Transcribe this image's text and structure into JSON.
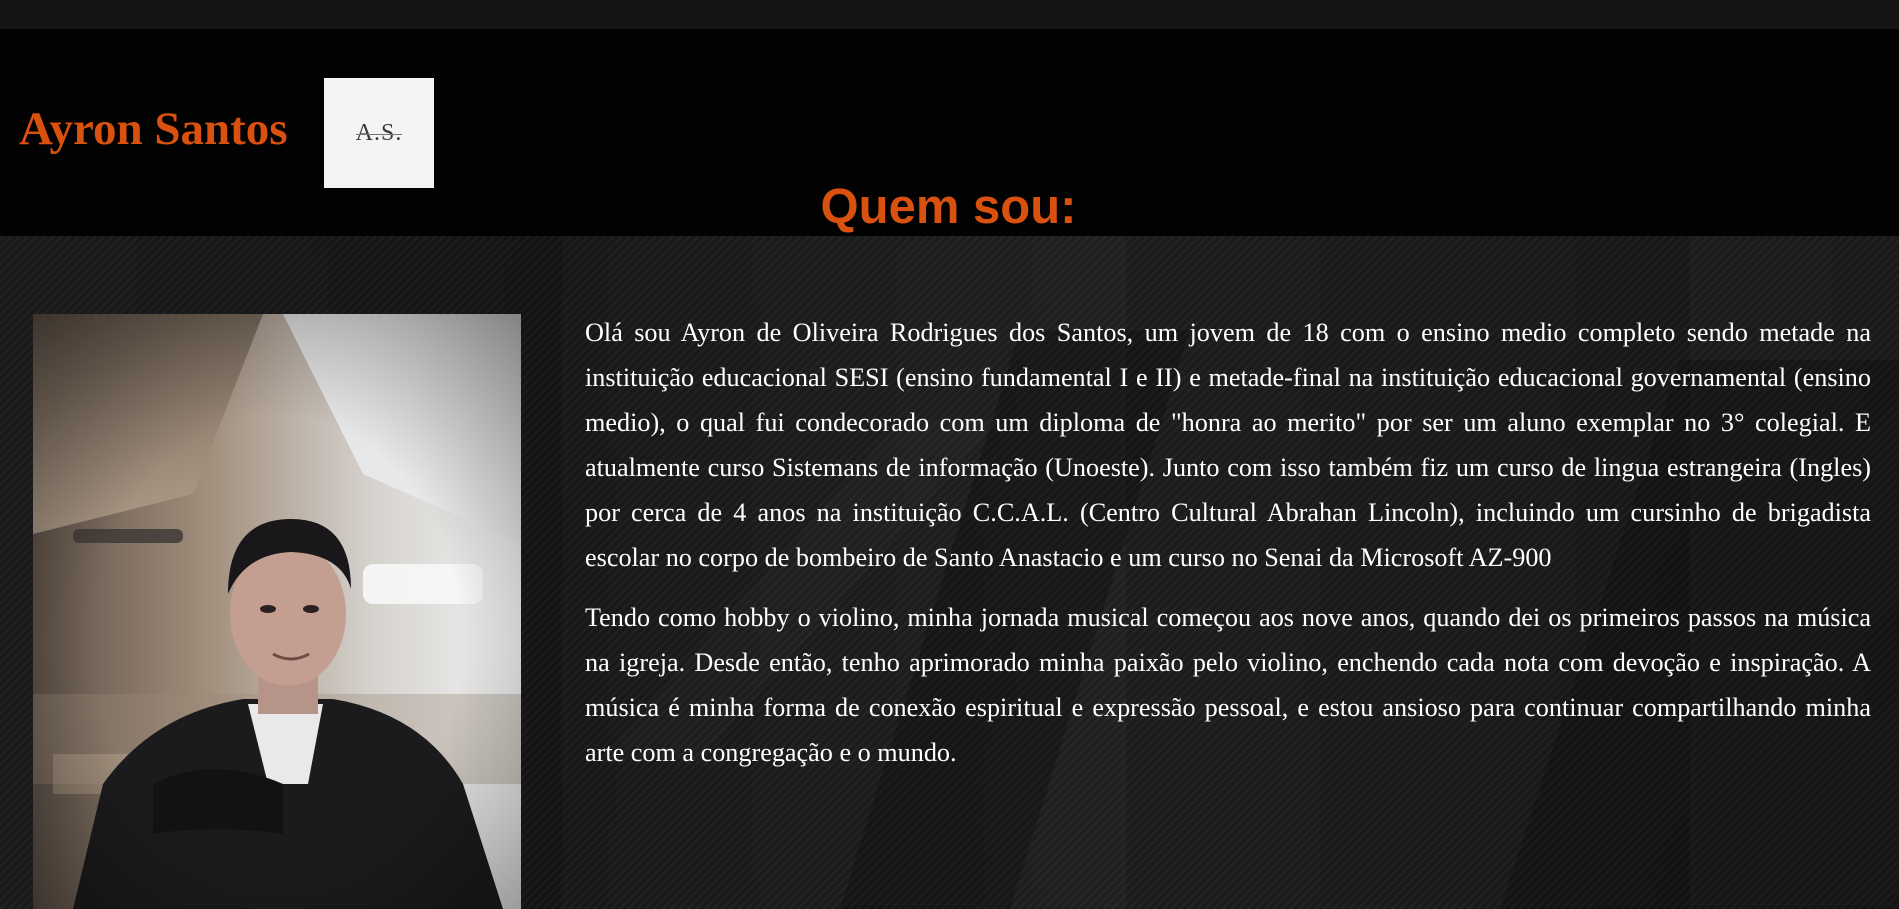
{
  "header": {
    "title": "Ayron Santos",
    "logo_text": "A.S."
  },
  "about": {
    "heading": "Quem sou:",
    "paragraphs": [
      "Olá sou Ayron de Oliveira Rodrigues dos Santos, um jovem de 18 com o ensino medio completo sendo metade na instituição educacional SESI (ensino fundamental I e II) e metade-final na instituição educacional governamental (ensino medio), o qual fui condecorado com um diploma de \"honra ao merito\" por ser um aluno exemplar no 3° colegial. E atualmente curso Sistemans de informação (Unoeste). Junto com isso também fiz um curso de lingua estrangeira (Ingles) por cerca de 4 anos na instituição C.C.A.L. (Centro Cultural Abrahan Lincoln), incluindo um cursinho de brigadista escolar no corpo de bombeiro de Santo Anastacio e um curso no Senai da Microsoft AZ-900",
      "Tendo como hobby o violino, minha jornada musical começou aos nove anos, quando dei os primeiros passos na música na igreja. Desde então, tenho aprimorado minha paixão pelo violino, enchendo cada nota com devoção e inspiração. A música é minha forma de conexão espiritual e expressão pessoal, e estou ansioso para continuar compartilhando minha arte com a congregação e o mundo."
    ]
  },
  "colors": {
    "accent": "#d9510f",
    "header_bg": "#020202",
    "page_bg": "#121212",
    "text": "#ffffff"
  }
}
